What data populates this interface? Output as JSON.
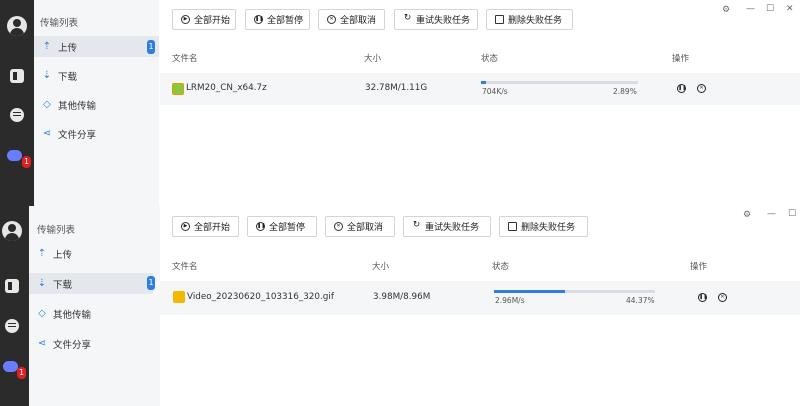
{
  "upload_window": {
    "sidebar": {
      "title": "传输列表",
      "items": [
        {
          "label": "上传",
          "icon": "upload-icon",
          "badge": "1",
          "active": true
        },
        {
          "label": "下载",
          "icon": "download-icon"
        },
        {
          "label": "其他传输",
          "icon": "transfer-icon"
        },
        {
          "label": "文件分享",
          "icon": "share-icon"
        }
      ]
    },
    "rail_badge": "1",
    "toolbar": {
      "start_all": "全部开始",
      "pause_all": "全部暂停",
      "cancel_all": "全部取消",
      "retry_failed": "重试失败任务",
      "delete_failed": "删除失败任务"
    },
    "columns": {
      "name": "文件名",
      "size": "大小",
      "status": "状态",
      "actions": "操作"
    },
    "tasks": [
      {
        "name": "LRM20_CN_x64.7z",
        "size": "32.78M/1.11G",
        "speed": "704K/s",
        "percent": "2.89%",
        "progress": 0.0289
      }
    ]
  },
  "download_window": {
    "sidebar": {
      "title": "传输列表",
      "items": [
        {
          "label": "上传",
          "icon": "upload-icon"
        },
        {
          "label": "下载",
          "icon": "download-icon",
          "badge": "1",
          "active": true
        },
        {
          "label": "其他传输",
          "icon": "transfer-icon"
        },
        {
          "label": "文件分享",
          "icon": "share-icon"
        }
      ]
    },
    "rail_badge": "1",
    "toolbar": {
      "start_all": "全部开始",
      "pause_all": "全部暂停",
      "cancel_all": "全部取消",
      "retry_failed": "重试失败任务",
      "delete_failed": "删除失败任务"
    },
    "columns": {
      "name": "文件名",
      "size": "大小",
      "status": "状态",
      "actions": "操作"
    },
    "tasks": [
      {
        "name": "Video_20230620_103316_320.gif",
        "size": "3.98M/8.96M",
        "speed": "2.96M/s",
        "percent": "44.37%",
        "progress": 0.4437
      }
    ]
  },
  "colors": {
    "accent": "#2e7de0",
    "rail": "#2b2b2b",
    "sidebar": "#f5f6f7",
    "badge_red": "#e02020"
  }
}
